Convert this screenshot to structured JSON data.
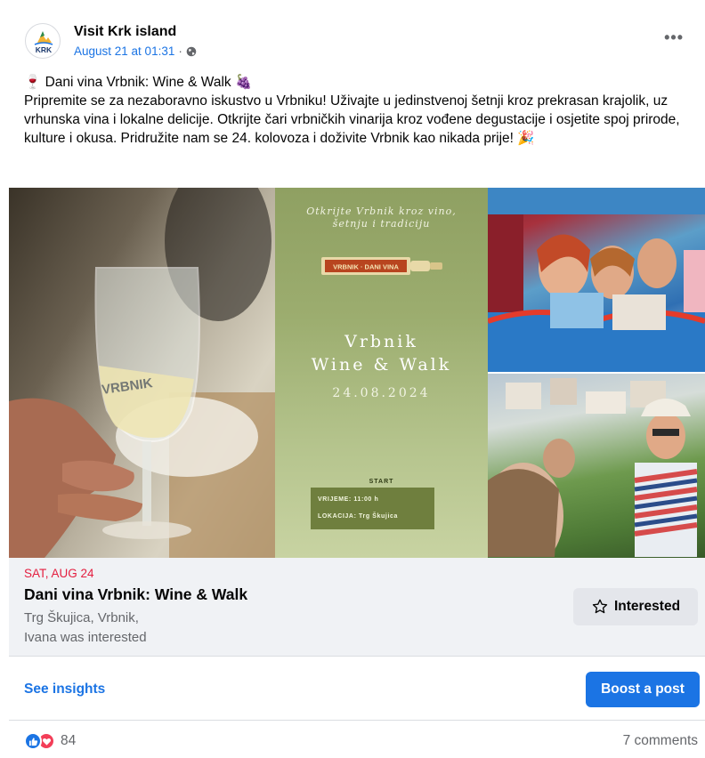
{
  "post": {
    "page_name": "Visit Krk island",
    "avatar_text": "KRK",
    "timestamp": "August 21 at 01:31",
    "separator": "·",
    "more_label": "•••",
    "text_lines": [
      "🍷 Dani vina Vrbnik: Wine & Walk 🍇",
      "Pripremite se za nezaboravno iskustvo u Vrbniku! Uživajte u jedinstvenoj šetnji kroz prekrasan krajolik, uz vrhunska vina i lokalne delicije. Otkrijte čari vrbničkih vinarija kroz vođene degustacije i osjetite spoj prirode, kulture i okusa. Pridružite nam se 24. kolovoza i doživite Vrbnik kao nikada prije! 🎉"
    ]
  },
  "poster": {
    "tagline_1": "Otkrijte Vrbnik kroz vino,",
    "tagline_2": "šetnju i tradiciju",
    "bottle_label": "VRBNIK · DANI VINA",
    "title_1": "Vrbnik",
    "title_2": "Wine & Walk",
    "date": "24.08.2024",
    "start_label": "START",
    "time_line": "VRIJEME: 11:00 h",
    "location_line": "LOKACIJA: Trg Škujica"
  },
  "glass_label": "VRBNIK",
  "event": {
    "date": "SAT, AUG 24",
    "title": "Dani vina Vrbnik: Wine & Walk",
    "location": "Trg Škujica, Vrbnik,",
    "interest_note": "Ivana was interested",
    "interested_label": "Interested"
  },
  "actions": {
    "insights_label": "See insights",
    "boost_label": "Boost a post"
  },
  "footer": {
    "reaction_count": "84",
    "comments_label": "7 comments"
  },
  "colors": {
    "link_blue": "#1b74e4",
    "event_date_red": "#e41e3f",
    "secondary_text": "#65676b",
    "event_bg": "#f0f2f5",
    "poster_green": "#9cad6f"
  }
}
